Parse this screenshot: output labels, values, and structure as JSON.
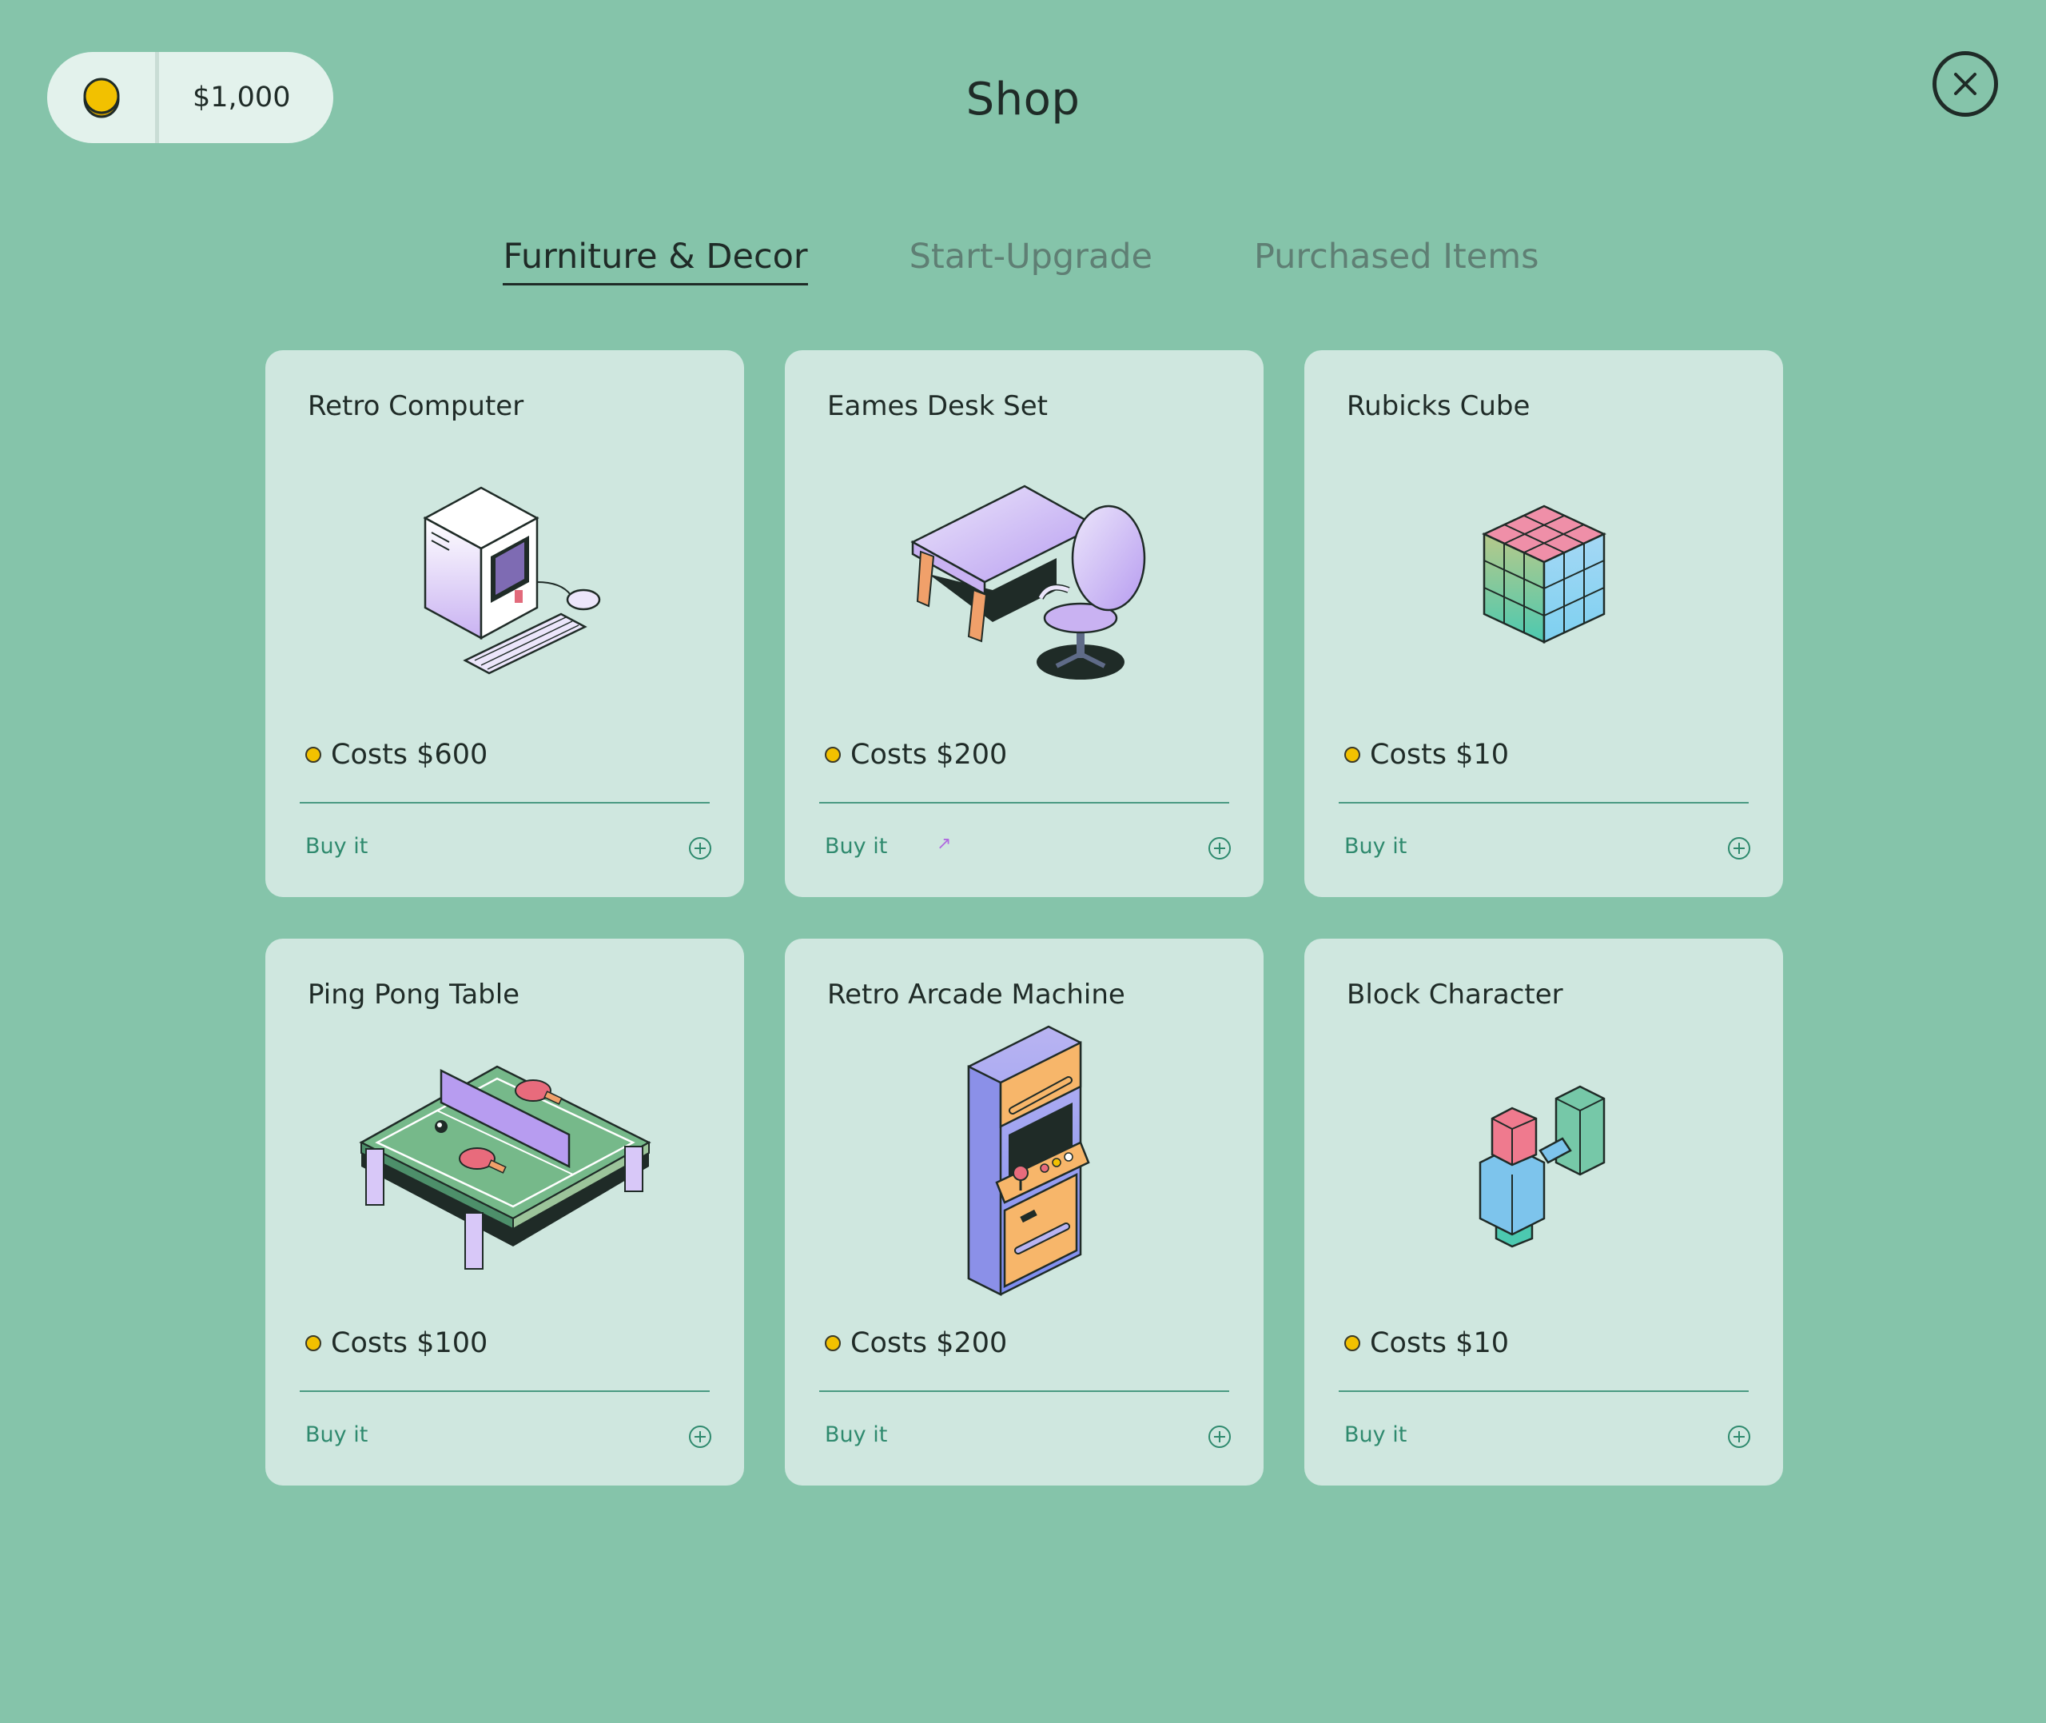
{
  "header": {
    "balance": "$1,000",
    "title": "Shop",
    "icons": {
      "coin": "coin-icon",
      "close": "close-icon"
    }
  },
  "tabs": [
    {
      "label": "Furniture & Decor",
      "active": true
    },
    {
      "label": "Start-Upgrade",
      "active": false
    },
    {
      "label": "Purchased Items",
      "active": false
    }
  ],
  "items": [
    {
      "name": "Retro Computer",
      "price": "Costs $600",
      "buy": "Buy it",
      "icon": "retro-computer-illustration"
    },
    {
      "name": "Eames Desk Set",
      "price": "Costs $200",
      "buy": "Buy it",
      "icon": "desk-set-illustration"
    },
    {
      "name": "Rubicks Cube",
      "price": "Costs $10",
      "buy": "Buy it",
      "icon": "rubiks-cube-illustration"
    },
    {
      "name": "Ping Pong Table",
      "price": "Costs $100",
      "buy": "Buy it",
      "icon": "ping-pong-table-illustration"
    },
    {
      "name": "Retro Arcade Machine",
      "price": "Costs $200",
      "buy": "Buy it",
      "icon": "arcade-machine-illustration"
    },
    {
      "name": "Block Character",
      "price": "Costs $10",
      "buy": "Buy it",
      "icon": "block-character-illustration"
    }
  ],
  "colors": {
    "background": "#85c4aa",
    "card": "#cfe7df",
    "accent": "#2f8a6e",
    "coin": "#f2c100"
  }
}
